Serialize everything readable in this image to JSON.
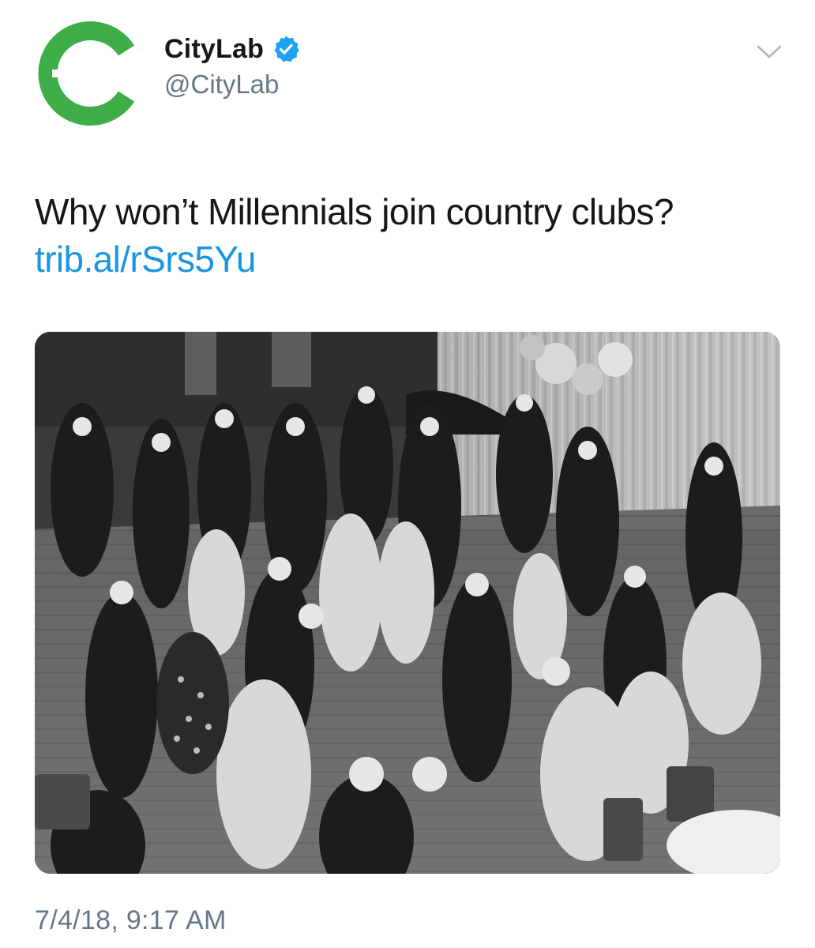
{
  "author": {
    "name": "CityLab",
    "handle": "@CityLab",
    "verified": true,
    "brand_color": "#3fae49",
    "verified_color": "#1da1f2"
  },
  "tweet": {
    "text": "Why won’t Millennials join country clubs? ",
    "link_text": "trib.al/rSrs5Yu",
    "link_color": "#1b95e0",
    "timestamp": "7/4/18, 9:17 AM"
  },
  "media": {
    "kind": "black-and-white photograph",
    "icon": "photo"
  },
  "icons": {
    "avatar": "citylab-logo-icon",
    "verified": "verified-badge-icon",
    "menu": "chevron-down-icon"
  }
}
